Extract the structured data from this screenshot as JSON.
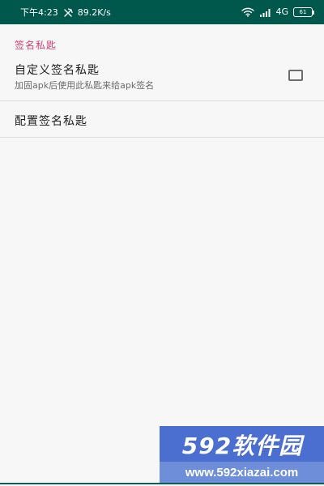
{
  "status_bar": {
    "time": "下午4:23",
    "speed": "89.2K/s",
    "network": "4G",
    "battery": "61",
    "icons": {
      "speed": "speed-icon",
      "wifi": "wifi-icon",
      "signal": "signal-icon",
      "battery": "battery-icon"
    }
  },
  "settings": {
    "section_title": "签名私匙",
    "custom_signature": {
      "title": "自定义签名私匙",
      "subtitle": "加固apk后使用此私匙来给apk签名",
      "checked": false
    },
    "configure_signature": {
      "title": "配置签名私匙"
    }
  },
  "watermark": {
    "brand": "592软件园",
    "url": "www.592xiazai.com"
  },
  "colors": {
    "status_bar": "#00574B",
    "section_title": "#D63D73",
    "watermark": "#4B6FD0"
  }
}
